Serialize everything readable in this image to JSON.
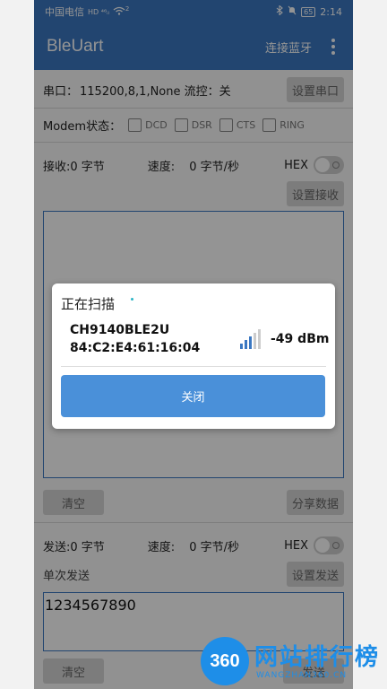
{
  "status_bar": {
    "carrier": "中国电信",
    "network_badges": "HD ⁴⁶ᵢₗ",
    "wifi_badge": "2",
    "battery": "65",
    "time": "2:14"
  },
  "appbar": {
    "title": "BleUart",
    "connect_label": "连接蓝牙"
  },
  "serial": {
    "label": "串口：",
    "value": "115200,8,1,None 流控：关",
    "button": "设置串口"
  },
  "modem": {
    "label": "Modem状态：",
    "signals": [
      "DCD",
      "DSR",
      "CTS",
      "RING"
    ]
  },
  "receive": {
    "label": "接收:0 字节",
    "speed_label": "速度:",
    "speed_value": "0 字节/秒",
    "hex_label": "HEX",
    "button": "设置接收",
    "clear_button": "清空",
    "share_button": "分享数据"
  },
  "send": {
    "label": "发送:0 字节",
    "speed_label": "速度:",
    "speed_value": "0 字节/秒",
    "hex_label": "HEX",
    "single_label": "单次发送",
    "button": "设置发送",
    "input_value": "1234567890",
    "clear_button": "清空",
    "send_button": "发送"
  },
  "dialog": {
    "title": "正在扫描",
    "device_name": "CH9140BLE2U",
    "device_mac": "84:C2:E4:61:16:04",
    "rssi": "-49 dBm",
    "signal_level": 0.6,
    "close_button": "关闭"
  },
  "watermark": {
    "badge": "360",
    "text": "网站排行榜",
    "subtext": "WANGZHAN360.CN"
  },
  "colors": {
    "primary": "#3b78c2",
    "button_blue": "#4a90d9",
    "watermark": "#1e8ee8"
  }
}
